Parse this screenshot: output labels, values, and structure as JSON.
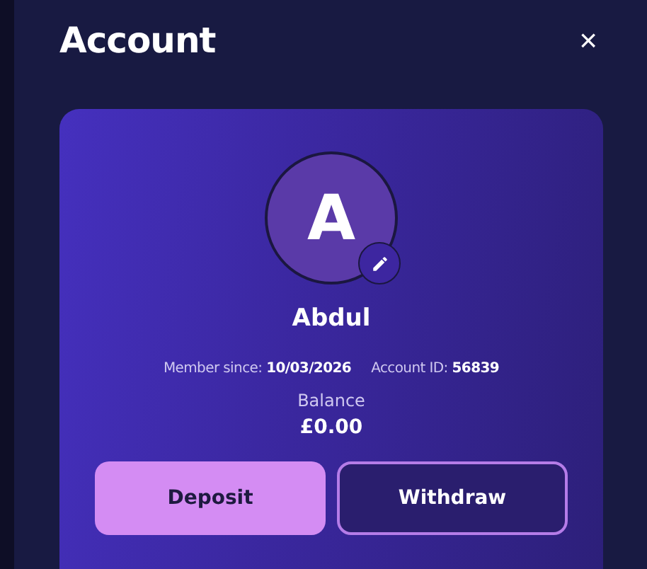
{
  "title": "Account",
  "close": "×",
  "profile": {
    "initial": "A",
    "name": "Abdul",
    "member_label": "Member since:",
    "member_since": "10/03/2026",
    "id_label": "Account ID:",
    "account_id": "56839",
    "balance_label": "Balance",
    "balance": "£0.00"
  },
  "buttons": [
    {
      "label": "Deposit",
      "kind": "primary"
    },
    {
      "label": "Withdraw",
      "kind": "outline"
    }
  ]
}
